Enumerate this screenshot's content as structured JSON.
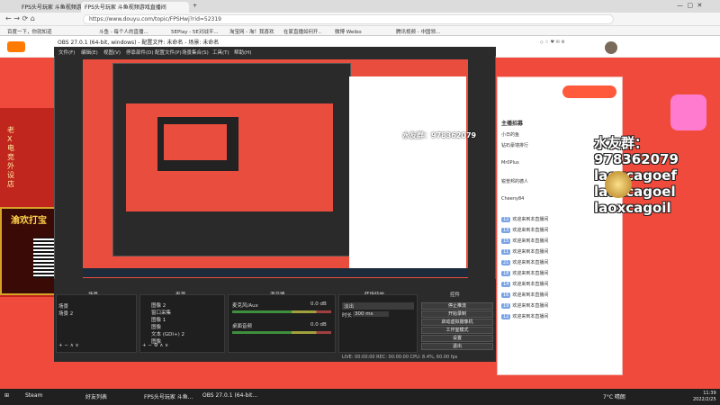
{
  "browser": {
    "tabs": [
      "FPS头号玩家 斗鱼视频游戏...",
      "FPS头号玩家 斗鱼视频游戏直播间"
    ],
    "new_tab": "+",
    "url": "https://www.douyu.com/topic/FPSHwj?rid=52319",
    "bookmarks": [
      "百度一下，你就知道",
      "斗鱼 - 每个人的直播...",
      "5EPlay - 5E对战平...",
      "淘宝网 - 淘！我喜欢",
      "在家直播如何开..",
      "微博 Weibo",
      "腾讯视频 - 中国领..."
    ]
  },
  "site": {
    "chat_header": "主播招募",
    "chat_tabs": [
      "小日的鱼",
      "钻石豪墙排行"
    ],
    "chat_users": [
      "Mr0Plus",
      "锐普邦的德人",
      "Cheeny84"
    ],
    "chat_msgs": [
      "欢迎来到本直播间",
      "欢迎来到本直播间",
      "欢迎来到本直播间",
      "欢迎来到本直播间",
      "欢迎来到本直播间",
      "欢迎来到本直播间",
      "欢迎来到本直播间",
      "欢迎来到本直播间",
      "欢迎来到本直播间",
      "欢迎来到本直播间"
    ],
    "overlay_lines": [
      "水友群：978362079",
      "laoxcagoef",
      "laoxcagoel",
      "laoxcagoil"
    ],
    "promo_title": "渝欢打宝",
    "left_promo": [
      "老",
      "X",
      "电",
      "竞",
      "外",
      "设",
      "店"
    ]
  },
  "obs": {
    "title": "OBS 27.0.1 (64-bit, windows) - 配置文件: 未命名 - 场景: 未命名",
    "menu": [
      "文件(F)",
      "编辑(E)",
      "视图(V)",
      "停靠部件(D)",
      "配置文件(P)",
      "场景集合(S)",
      "工具(T)",
      "帮助(H)"
    ],
    "dock_headers": [
      "场景",
      "来源",
      "混音器",
      "转场特效",
      "控件"
    ],
    "scenes": [
      "场景",
      "场景 2"
    ],
    "sources": [
      "图像 2",
      "窗口采集",
      "图像 1",
      "图像",
      "文本 (GDI+) 2",
      "图像"
    ],
    "mixer": [
      {
        "name": "麦克风/Aux",
        "level": "0.0 dB"
      },
      {
        "name": "桌面音频",
        "level": "0.0 dB"
      }
    ],
    "transition": {
      "type": "淡出",
      "duration_label": "时长",
      "duration": "300 ms"
    },
    "controls": [
      "停止推流",
      "开始录制",
      "启动虚拟摄像机",
      "工作室模式",
      "设置",
      "退出"
    ],
    "status": "LIVE: 00:00:00    REC: 00:00:00    CPU: 8.4%, 60.00 fps"
  },
  "taskbar": {
    "items": [
      "Steam",
      "好友列表",
      "FPS头号玩家 斗鱼...",
      "OBS 27.0.1 (64-bit..."
    ],
    "weather": "7°C 晴朗",
    "time": "11:39",
    "date": "2022/2/25"
  }
}
